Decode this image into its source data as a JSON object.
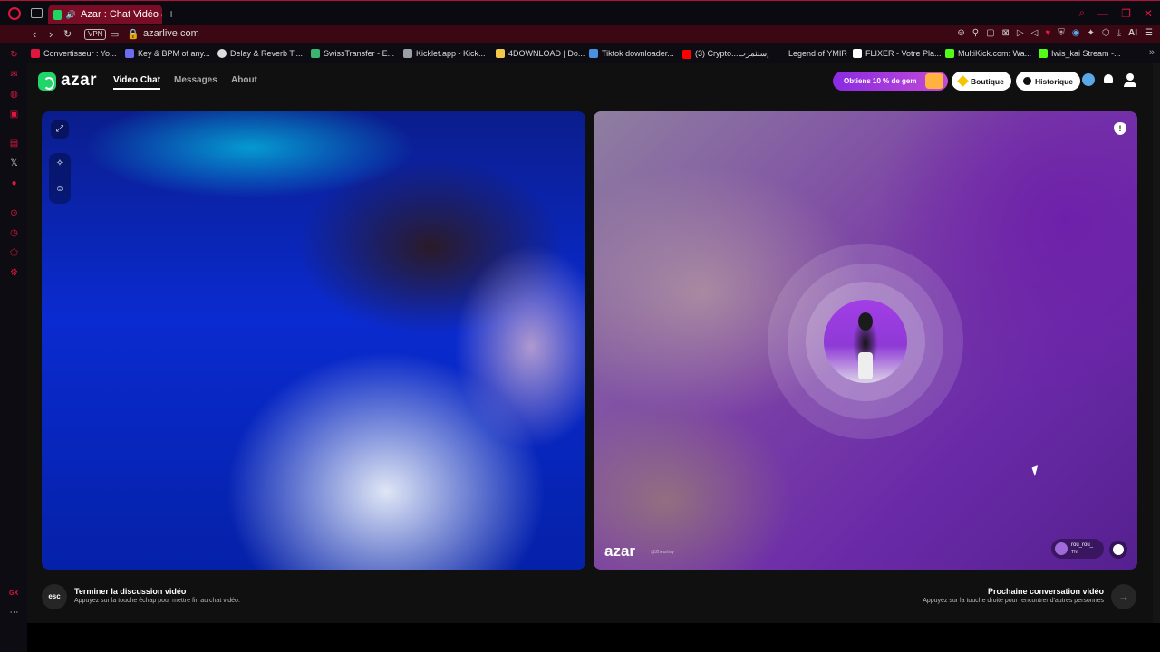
{
  "browser": {
    "tab_title": "Azar : Chat Vidéo avec",
    "url": "azarlive.com",
    "vpn_label": "VPN",
    "ai_label": "AI",
    "bookmarks": [
      {
        "label": "Convertisseur : Yo...",
        "icon": "youtube-converter-icon",
        "color": "#e0163f"
      },
      {
        "label": "Key & BPM of any...",
        "icon": "note-icon",
        "color": "#6c6cf0"
      },
      {
        "label": "Delay & Reverb Ti...",
        "icon": "clock-icon",
        "color": "#dddddd"
      },
      {
        "label": "SwissTransfer - E...",
        "icon": "swisstransfer-icon",
        "color": "#3cb371"
      },
      {
        "label": "Kicklet.app - Kick...",
        "icon": "kicklet-icon",
        "color": "#9aa0a6"
      },
      {
        "label": "4DOWNLOAD | Do...",
        "icon": "folder-icon",
        "color": "#f2c94c"
      },
      {
        "label": "Tiktok downloader...",
        "icon": "download-icon",
        "color": "#4a90e2"
      },
      {
        "label": "(3) Crypto...إستثمرت",
        "icon": "youtube-icon",
        "color": "#ff0000"
      },
      {
        "label": "Legend of YMIR",
        "icon": "",
        "color": ""
      },
      {
        "label": "FLIXER - Votre Pla...",
        "icon": "flixer-icon",
        "color": "#ffffff"
      },
      {
        "label": "MultiKick.com: Wa...",
        "icon": "multikick-icon",
        "color": "#53fc18"
      },
      {
        "label": "Iwis_kai Stream -...",
        "icon": "kick-icon",
        "color": "#53fc18"
      }
    ]
  },
  "header": {
    "logo_text": "azar",
    "nav": [
      "Video Chat",
      "Messages",
      "About"
    ],
    "promo_text": "Obtiens 10 % de gem",
    "boutique_label": "Boutique",
    "historique_label": "Historique"
  },
  "remote": {
    "watermark_logo": "azar",
    "watermark_handle": "@Zheurtiny",
    "user_name": "rou_rou_",
    "user_country": "TN"
  },
  "footer": {
    "esc_key": "esc",
    "end_title": "Terminer la discussion vidéo",
    "end_sub": "Appuyez sur la touche échap pour mettre fin au chat vidéo.",
    "next_title": "Prochaine conversation vidéo",
    "next_sub": "Appuyez sur la touche droite pour rencontrer d'autres personnes",
    "next_key": "→"
  },
  "colors": {
    "accent_red": "#e0163f",
    "azar_green": "#21d56a",
    "promo_purple": "#8a2be2"
  }
}
